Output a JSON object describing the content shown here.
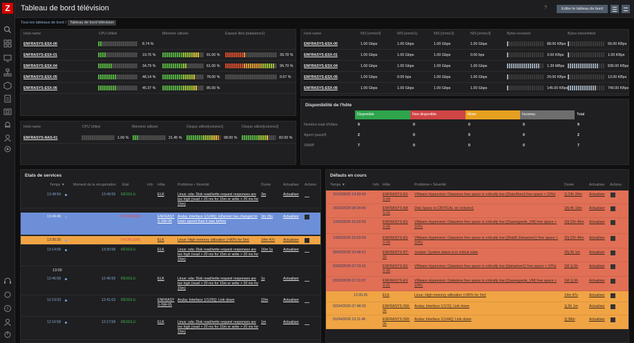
{
  "app": {
    "logo": "Z",
    "title": "Tableau de bord télévision",
    "help": "?",
    "edit_label": "Editer le tableau de bord"
  },
  "breadcrumb": {
    "root": "Tous les tableaux de bord",
    "sep": "/",
    "current": "Tableau de bord télévision"
  },
  "colors": {
    "accent": "#d40000",
    "ok": "#39b54a",
    "problem": "#e05050",
    "available": "#2ea54d",
    "unavailable": "#d04545",
    "mixed": "#e6a020",
    "unknown": "#6e6e6e",
    "row_problem": "#e06f55",
    "row_high": "#f0a444",
    "row_info": "#6c8fd8"
  },
  "esx": {
    "cols": [
      "Host name",
      "CPU Utilisé",
      "Mémoire utilisée",
      "Espace libre [datastore1]"
    ],
    "rows": [
      {
        "name": "ENFRASYS-ESX-00",
        "cpu": "8.74 %",
        "cpu_frac": 0.09,
        "mem": "",
        "mem_frac": 0,
        "ds": "",
        "ds_frac": 0
      },
      {
        "name": "ENFRASYS-ESX-01",
        "cpu": "19.76 %",
        "cpu_frac": 0.2,
        "mem": "91.00 %",
        "mem_frac": 0.91,
        "ds": "39.78 %",
        "ds_frac": 0.4
      },
      {
        "name": "ENFRASYS-ESX-04",
        "cpu": "34.79 %",
        "cpu_frac": 0.35,
        "mem": "61.00 %",
        "mem_frac": 0.61,
        "ds": "96.79 %",
        "ds_frac": 0.97
      },
      {
        "name": "ENFRASYS-ESX-05",
        "cpu": "48.14 %",
        "cpu_frac": 0.48,
        "mem": "78.00 %",
        "mem_frac": 0.78,
        "ds": "0.07 %",
        "ds_frac": 0.01
      },
      {
        "name": "ENFRASYS-ESX-06",
        "cpu": "45.37 %",
        "cpu_frac": 0.45,
        "mem": "85.00 %",
        "mem_frac": 0.85,
        "ds": "",
        "ds_frac": 0
      }
    ]
  },
  "net": {
    "cols": [
      "Host name",
      "NIS [vmnic0]",
      "NIS [vmnic1]",
      "NIS [vmnic2]",
      "NIS [vmnic3]",
      "Bytes received",
      "Bytes transmitted"
    ],
    "rows": [
      {
        "name": "ENFRASYS-ESX-00",
        "n0": "1.00 Gbps",
        "n1": "1.00 Gbps",
        "n2": "1.00 Gbps",
        "n3": "1.00 Gbps",
        "rx": "88.00 KBps",
        "rx_frac": 0.05,
        "tx": "56.00 KBps",
        "tx_frac": 0.03
      },
      {
        "name": "ENFRASYS-ESX-01",
        "n0": "1.00 Gbps",
        "n1": "1.00 Gbps",
        "n2": "1.00 Gbps",
        "n3": "0.00 bps",
        "rx": "3.00 KBps",
        "rx_frac": 0.02,
        "tx": "1.00 KBps",
        "tx_frac": 0.02
      },
      {
        "name": "ENFRASYS-ESX-04",
        "n0": "1.00 Gbps",
        "n1": "1.00 Gbps",
        "n2": "1.00 Gbps",
        "n3": "1.00 Gbps",
        "rx": "1.39 MBps",
        "rx_frac": 0.9,
        "tx": "836.00 KBps",
        "tx_frac": 0.85
      },
      {
        "name": "ENFRASYS-ESX-05",
        "n0": "1.00 Gbps",
        "n1": "0.00 bps",
        "n2": "1.00 Gbps",
        "n3": "1.00 Gbps",
        "rx": "20.00 KBps",
        "rx_frac": 0.03,
        "tx": "13.00 KBps",
        "tx_frac": 0.02
      },
      {
        "name": "ENFRASYS-ESX-06",
        "n0": "1.00 Gbps",
        "n1": "1.00 Gbps",
        "n2": "1.00 Gbps",
        "n3": "1.00 Gbps",
        "rx": "145.00 KBps",
        "rx_frac": 0.06,
        "tx": "740.00 KBps",
        "tx_frac": 0.8
      }
    ]
  },
  "nas": {
    "cols": [
      "Host name",
      "CPU Utilisé",
      "Mémoire utilisée",
      "Disque utilisé[volume1]",
      "Disque utilisé[volume2]"
    ],
    "row": {
      "name": "ENFRASYS-NAS-01",
      "cpu": "1.00 %",
      "cpu_frac": 0.01,
      "mem": "21.45 %",
      "mem_frac": 0.21,
      "v1": "98.00 %",
      "v1_frac": 0.98,
      "v2": "82.00 %",
      "v2_frac": 0.82
    }
  },
  "avail": {
    "title": "Disponibilité de l'hôte",
    "heads": [
      "Disponible",
      "Non disponible",
      "Mixte",
      "Inconnu",
      "Total"
    ],
    "rows": [
      {
        "label": "Nombre total d'hôtes",
        "v": [
          "9",
          "0",
          "0",
          "0",
          "9"
        ]
      },
      {
        "label": "Agent (passif)",
        "v": [
          "2",
          "0",
          "0",
          "0",
          "2"
        ]
      },
      {
        "label": "SNMP",
        "v": [
          "7",
          "0",
          "0",
          "0",
          "7"
        ]
      }
    ]
  },
  "services": {
    "title": "Etats de services",
    "cols": [
      "Temps ▼",
      "Moment de la récupération",
      "Etat",
      "Info",
      "Hôte",
      "Problème • Sévérité",
      "Durée",
      "Actualiser",
      "Actions"
    ],
    "day_label": "13:00",
    "rows": [
      {
        "time": "13:48:59",
        "rec": "13:49:59",
        "state": "RÉSOLU",
        "host": "ELK",
        "problem": "Linux: sda: Disk read/write request responses are too high (read > 20 ms for 15m or write > 20 ms for 15m)",
        "dur": "3m",
        "ack": "Actualiser",
        "kind": "ok"
      },
      {
        "time": "13:46:46",
        "rec": "",
        "state": "PROBLÈME",
        "host": "ENFRASYS-SW-06",
        "problem": "Aruba: Interface 1/1/49(): Ethernet has changed to lower speed than it was before",
        "dur": "3m 26s",
        "ack": "Actualiser",
        "kind": "info"
      },
      {
        "time": "13:35:25",
        "rec": "",
        "state": "PROBLÈME",
        "host": "ELK",
        "problem": "Linux: High memory utilization (>90% for 5m)",
        "dur": "14m 47s",
        "ack": "Actualiser",
        "kind": "high"
      },
      {
        "time": "13:14:58",
        "rec": "13:30:58",
        "state": "RÉSOLU",
        "host": "ELK",
        "problem": "Linux: sda: Disk read/write request responses are too high (read > 20 ms for 15m or write > 20 ms for 15m)",
        "dur": "16m 1s",
        "ack": "Actualiser",
        "kind": "ok"
      },
      {
        "time": "12:46:58",
        "rec": "12:46:59",
        "state": "RÉSOLU",
        "host": "ELK",
        "problem": "Linux: sda: Disk read/write request responses are too high (read > 20 ms for 15m or write > 20 ms for 15m)",
        "dur": "1s",
        "ack": "Actualiser",
        "kind": "ok"
      },
      {
        "time": "12:19:03",
        "rec": "12:41:03",
        "state": "RÉSOLU",
        "host": "ENFRASYS-SW-05",
        "problem": "Aruba: Interface 1/1/25(): Link down",
        "dur": "22m",
        "ack": "Actualiser",
        "kind": "ok"
      },
      {
        "time": "12:16:58",
        "rec": "12:17:58",
        "state": "RÉSOLU",
        "host": "ELK",
        "problem": "Linux: sda: Disk read/write request responses are too high (read > 20 ms for 15m or write > 20 ms for 15m)",
        "dur": "1m",
        "ack": "Actualiser",
        "kind": "ok"
      }
    ]
  },
  "defauts": {
    "title": "Défauts en cours",
    "cols": [
      "Temps ▼",
      "Info",
      "Hôte",
      "Problème • Sévérité",
      "Durée",
      "Actualiser",
      "Actions"
    ],
    "rows": [
      {
        "time": "31/03/2026 14:29:43",
        "host": "ENFRASYS-ESX-04",
        "problem": "VMware Hypervisor: Datastore free space is critically low ({DataStore} free space < 10%)",
        "dur": "2j 23h 20m",
        "ack": "Actualiser",
        "kind": "disaster"
      },
      {
        "time": "16/03/2026 08:34:40",
        "host": "ENFRASYS-NAS-01",
        "problem": "Disk Space is CRITICAL on /volume1",
        "dur": "18j 4h 15m",
        "ack": "Actualiser",
        "kind": "disaster"
      },
      {
        "time": "13/03/2026 15:03:59",
        "host": "ENFRASYS-ESX-00",
        "problem": "VMware Hypervisor: Datastore free space is critically low ({Sauvegarde_VM} free space < 10%)",
        "dur": "20j 22h 46m",
        "ack": "Actualiser",
        "kind": "disaster"
      },
      {
        "time": "13/03/2026 15:03:59",
        "host": "ENFRASYS-ESX-00",
        "problem": "VMware Hypervisor: Datastore free space is critically low ({Raid5-Datastore1} free space < 10%)",
        "dur": "20j 22h 46m",
        "ack": "Actualiser",
        "kind": "disaster"
      },
      {
        "time": "09/03/2026 10:48:51",
        "host": "ENFRASYS-RT-02",
        "problem": "Juniper: System status is in critical state",
        "dur": "25j 3h 1m",
        "ack": "Actualiser",
        "kind": "disaster"
      },
      {
        "time": "03/03/2026 07:23:16",
        "host": "ENFRASYS-ESX-05",
        "problem": "VMware Hypervisor: Datastore free space is critically low ({datastore1} free space < 10%)",
        "dur": "1M 1j 6h",
        "ack": "Actualiser",
        "kind": "disaster"
      },
      {
        "time": "03/03/2026 07:21:57",
        "host": "ENFRASYS-ESX-01",
        "problem": "VMware Hypervisor: Datastore free space is critically low ({Sauvegarde_VM} free space < 10%)",
        "dur": "1M 1j 6h",
        "ack": "Actualiser",
        "kind": "disaster"
      },
      {
        "time": "13:35:25",
        "host": "ELK",
        "problem": "Linux: High memory utilization (>90% for 5m)",
        "dur": "14m 47s",
        "ack": "Actualiser",
        "kind": "high"
      },
      {
        "time": "02/04/2026 07:48:03",
        "host": "ENFRASYS-SW-05",
        "problem": "Aruba: Interface 1/1/7(): Link down",
        "dur": "1j 6h 1m",
        "ack": "Actualiser",
        "kind": "high"
      },
      {
        "time": "01/04/2026 13:11:46",
        "host": "ENFRASYS-SW-06",
        "problem": "Aruba: Interface 1/1/44(): Link down",
        "dur": "2j 38m",
        "ack": "Actualiser",
        "kind": "high"
      }
    ]
  }
}
